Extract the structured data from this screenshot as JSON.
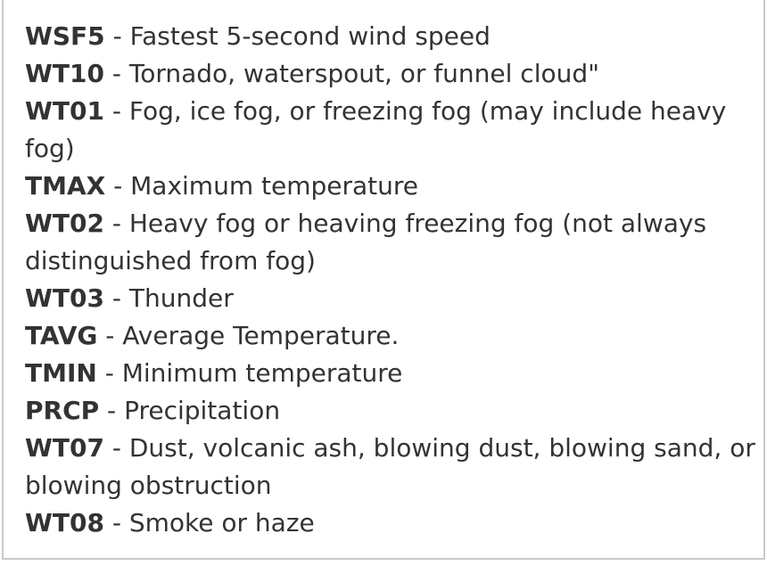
{
  "separator": " - ",
  "entries": [
    {
      "code": "WSF5",
      "description": "Fastest 5-second wind speed"
    },
    {
      "code": "WT10",
      "description": "Tornado, waterspout, or funnel cloud\""
    },
    {
      "code": "WT01",
      "description": "Fog, ice fog, or freezing fog (may include heavy fog)"
    },
    {
      "code": "TMAX",
      "description": "Maximum temperature"
    },
    {
      "code": "WT02",
      "description": "Heavy fog or heaving freezing fog (not always distinguished from fog)"
    },
    {
      "code": "WT03",
      "description": "Thunder"
    },
    {
      "code": "TAVG",
      "description": "Average Temperature."
    },
    {
      "code": "TMIN",
      "description": "Minimum temperature"
    },
    {
      "code": "PRCP",
      "description": "Precipitation"
    },
    {
      "code": "WT07",
      "description": "Dust, volcanic ash, blowing dust, blowing sand, or blowing obstruction"
    },
    {
      "code": "WT08",
      "description": "Smoke or haze"
    }
  ]
}
